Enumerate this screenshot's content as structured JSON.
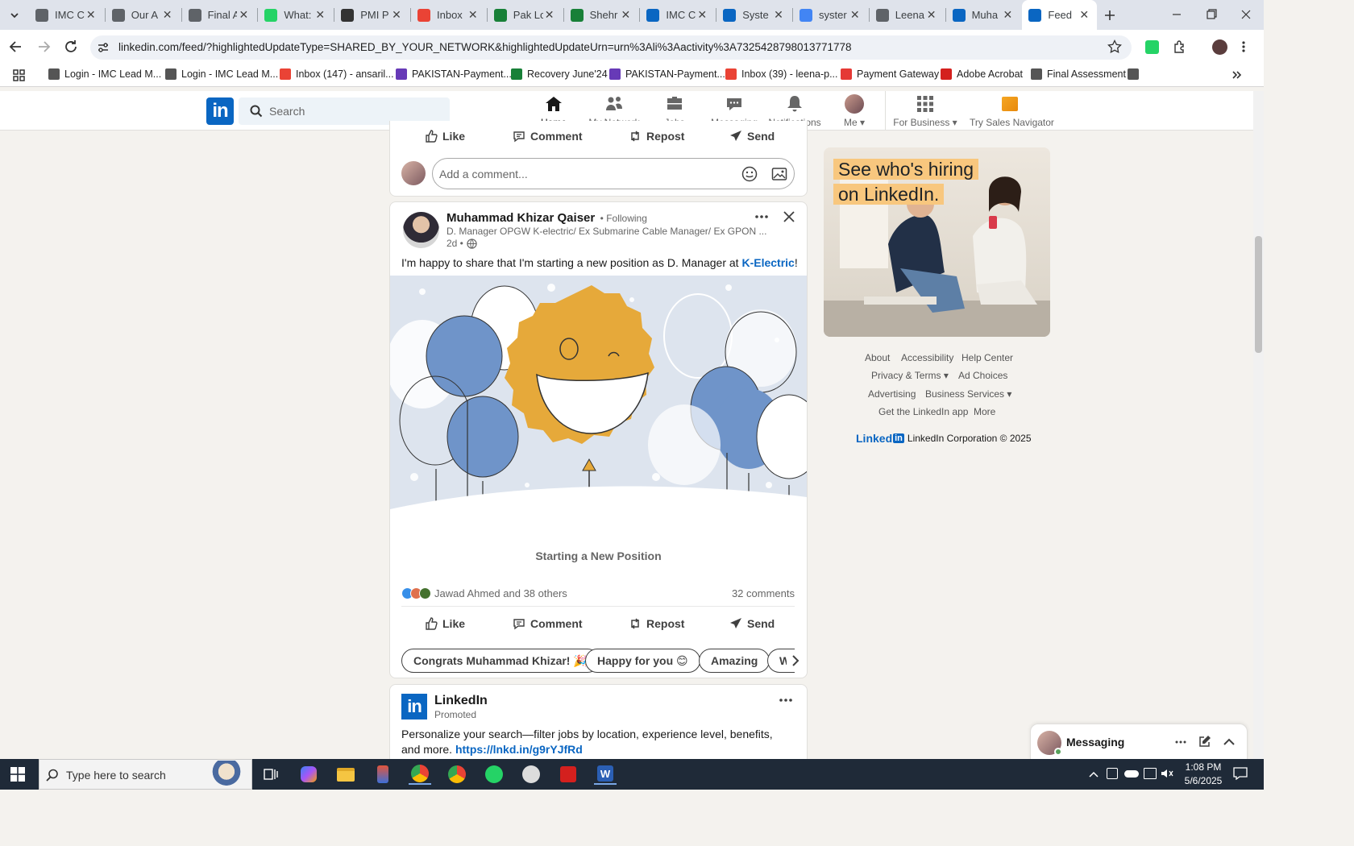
{
  "browser": {
    "tabs": [
      {
        "title": "IMC C",
        "icon": "feather",
        "color": "#5f6368"
      },
      {
        "title": "Our A",
        "icon": "feather",
        "color": "#5f6368"
      },
      {
        "title": "Final A",
        "icon": "feather",
        "color": "#5f6368"
      },
      {
        "title": "What:",
        "icon": "whatsapp",
        "color": "#25d366"
      },
      {
        "title": "PMI P",
        "icon": "pmi",
        "color": "#333333"
      },
      {
        "title": "Inbox",
        "icon": "gmail",
        "color": "#ea4335"
      },
      {
        "title": "Pak Lo",
        "icon": "sheets",
        "color": "#188038"
      },
      {
        "title": "Shehr",
        "icon": "sheets",
        "color": "#188038"
      },
      {
        "title": "IMC C",
        "icon": "linkedin",
        "color": "#0a66c2"
      },
      {
        "title": "Syste",
        "icon": "linkedin",
        "color": "#0a66c2"
      },
      {
        "title": "syster",
        "icon": "google",
        "color": "#4285f4"
      },
      {
        "title": "Leena",
        "icon": "feather",
        "color": "#5f6368"
      },
      {
        "title": "Muha",
        "icon": "linkedin",
        "color": "#0a66c2"
      },
      {
        "title": "Feed",
        "icon": "linkedin",
        "color": "#0a66c2",
        "active": true
      }
    ],
    "url": "linkedin.com/feed/?highlightedUpdateType=SHARED_BY_YOUR_NETWORK&highlightedUpdateUrn=urn%3Ali%3Aactivity%3A7325428798013771778",
    "bookmarks": [
      {
        "label": "Login - IMC Lead M...",
        "icon": "feather"
      },
      {
        "label": "Login - IMC Lead M...",
        "icon": "feather"
      },
      {
        "label": "Inbox (147) - ansaril...",
        "icon": "gmail"
      },
      {
        "label": "PAKISTAN-Payment...",
        "icon": "forms"
      },
      {
        "label": "Recovery June'24",
        "icon": "sheets"
      },
      {
        "label": "PAKISTAN-Payment...",
        "icon": "forms"
      },
      {
        "label": "Inbox (39) - leena-p...",
        "icon": "gmail"
      },
      {
        "label": "Payment Gateway",
        "icon": "payment"
      },
      {
        "label": "Adobe Acrobat",
        "icon": "acrobat"
      },
      {
        "label": "Final Assessment",
        "icon": "feather"
      }
    ]
  },
  "linkedin_nav": {
    "logo": "in",
    "search_placeholder": "Search",
    "items": [
      {
        "label": "Home",
        "icon": "home-icon",
        "active": true
      },
      {
        "label": "My Network",
        "icon": "network-icon"
      },
      {
        "label": "Jobs",
        "icon": "briefcase-icon"
      },
      {
        "label": "Messaging",
        "icon": "messaging-icon"
      },
      {
        "label": "Notifications",
        "icon": "bell-icon"
      },
      {
        "label": "Me",
        "icon": "avatar"
      }
    ],
    "for_business": "For Business",
    "sales_nav": "Try Sales Navigator"
  },
  "prev_post": {
    "actions": [
      "Like",
      "Comment",
      "Repost",
      "Send"
    ],
    "comment_placeholder": "Add a comment..."
  },
  "post": {
    "author": "Muhammad Khizar Qaiser",
    "following": "• Following",
    "headline": "D. Manager OPGW K-electric/ Ex Submarine Cable Manager/ Ex GPON ...",
    "time": "2d •",
    "text_before": "I'm happy to share that I'm starting a new position as D. Manager at ",
    "company_link": "K-Electric",
    "text_after": "!",
    "image_caption": "Starting a New Position",
    "reactions": "Jawad Ahmed and 38 others",
    "comments": "32 comments",
    "actions": [
      "Like",
      "Comment",
      "Repost",
      "Send"
    ],
    "suggestions": [
      "Congrats Muhammad Khizar! 🎉",
      "Happy for you 😊",
      "Amazing",
      "W"
    ]
  },
  "promoted": {
    "name": "LinkedIn",
    "label": "Promoted",
    "text": "Personalize your search—filter jobs by location, experience level, benefits, and more.",
    "link": "https://lnkd.in/g9rYJfRd"
  },
  "ad": {
    "line1": "See who's hiring",
    "line2": "on LinkedIn."
  },
  "footer": {
    "links": [
      "About",
      "Accessibility",
      "Help Center",
      "Privacy & Terms",
      "Ad Choices",
      "Advertising",
      "Business Services",
      "Get the LinkedIn app",
      "More"
    ],
    "brand": "Linked",
    "brand_in": "in",
    "copyright": "LinkedIn Corporation © 2025"
  },
  "messaging": {
    "label": "Messaging"
  },
  "taskbar": {
    "search_placeholder": "Type here to search",
    "time": "1:08 PM",
    "date": "5/6/2025"
  }
}
